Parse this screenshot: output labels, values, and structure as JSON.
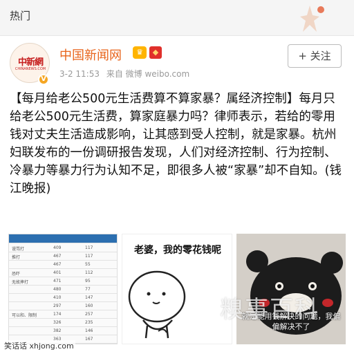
{
  "header": {
    "tab_label": "热门"
  },
  "post": {
    "author": "中国新闻网",
    "avatar_text": "中新網",
    "avatar_sub": "CHINANEWS.COM",
    "time": "3-2 11:53",
    "source": "来自 微博 weibo.com",
    "follow_label": "+ 关注",
    "text": "【每月给老公500元生活费算不算家暴？属经济控制】每月只给老公500元生活费，算家庭暴力吗？律师表示，若给的零用钱对丈夫生活造成影响，让其感到受人控制，就是家暴。杭州妇联发布的一份调研报告发现，人们对经济控制、行为控制、冷暴力等暴力行为认知不足，即很多人被“家暴”却不自知。(钱江晚报)"
  },
  "images": {
    "cartoon_caption": "老婆，我的零花钱呢",
    "bear_caption": "就是能用钱解决的问题，我偏偏解决不了",
    "table_rows": [
      [
        "谩骂打",
        "409",
        "117"
      ],
      [
        "推打",
        "467",
        "117"
      ],
      [
        "",
        "467",
        "55"
      ],
      [
        "恐吓",
        "401",
        "112"
      ],
      [
        "无故摔打",
        "471",
        "95"
      ],
      [
        "",
        "480",
        "77"
      ],
      [
        "",
        "410",
        "147"
      ],
      [
        "",
        "297",
        "160"
      ],
      [
        "可以和、限制",
        "174",
        "257"
      ],
      [
        "",
        "326",
        "235"
      ],
      [
        "",
        "382",
        "146"
      ],
      [
        "",
        "363",
        "167"
      ]
    ]
  },
  "watermarks": {
    "overlay": "糗事百科",
    "site": "笑话话 xhjong.com"
  },
  "colors": {
    "accent_orange": "#e8641b",
    "vip_gold": "#ffb400",
    "red_badge": "#e0302b"
  }
}
